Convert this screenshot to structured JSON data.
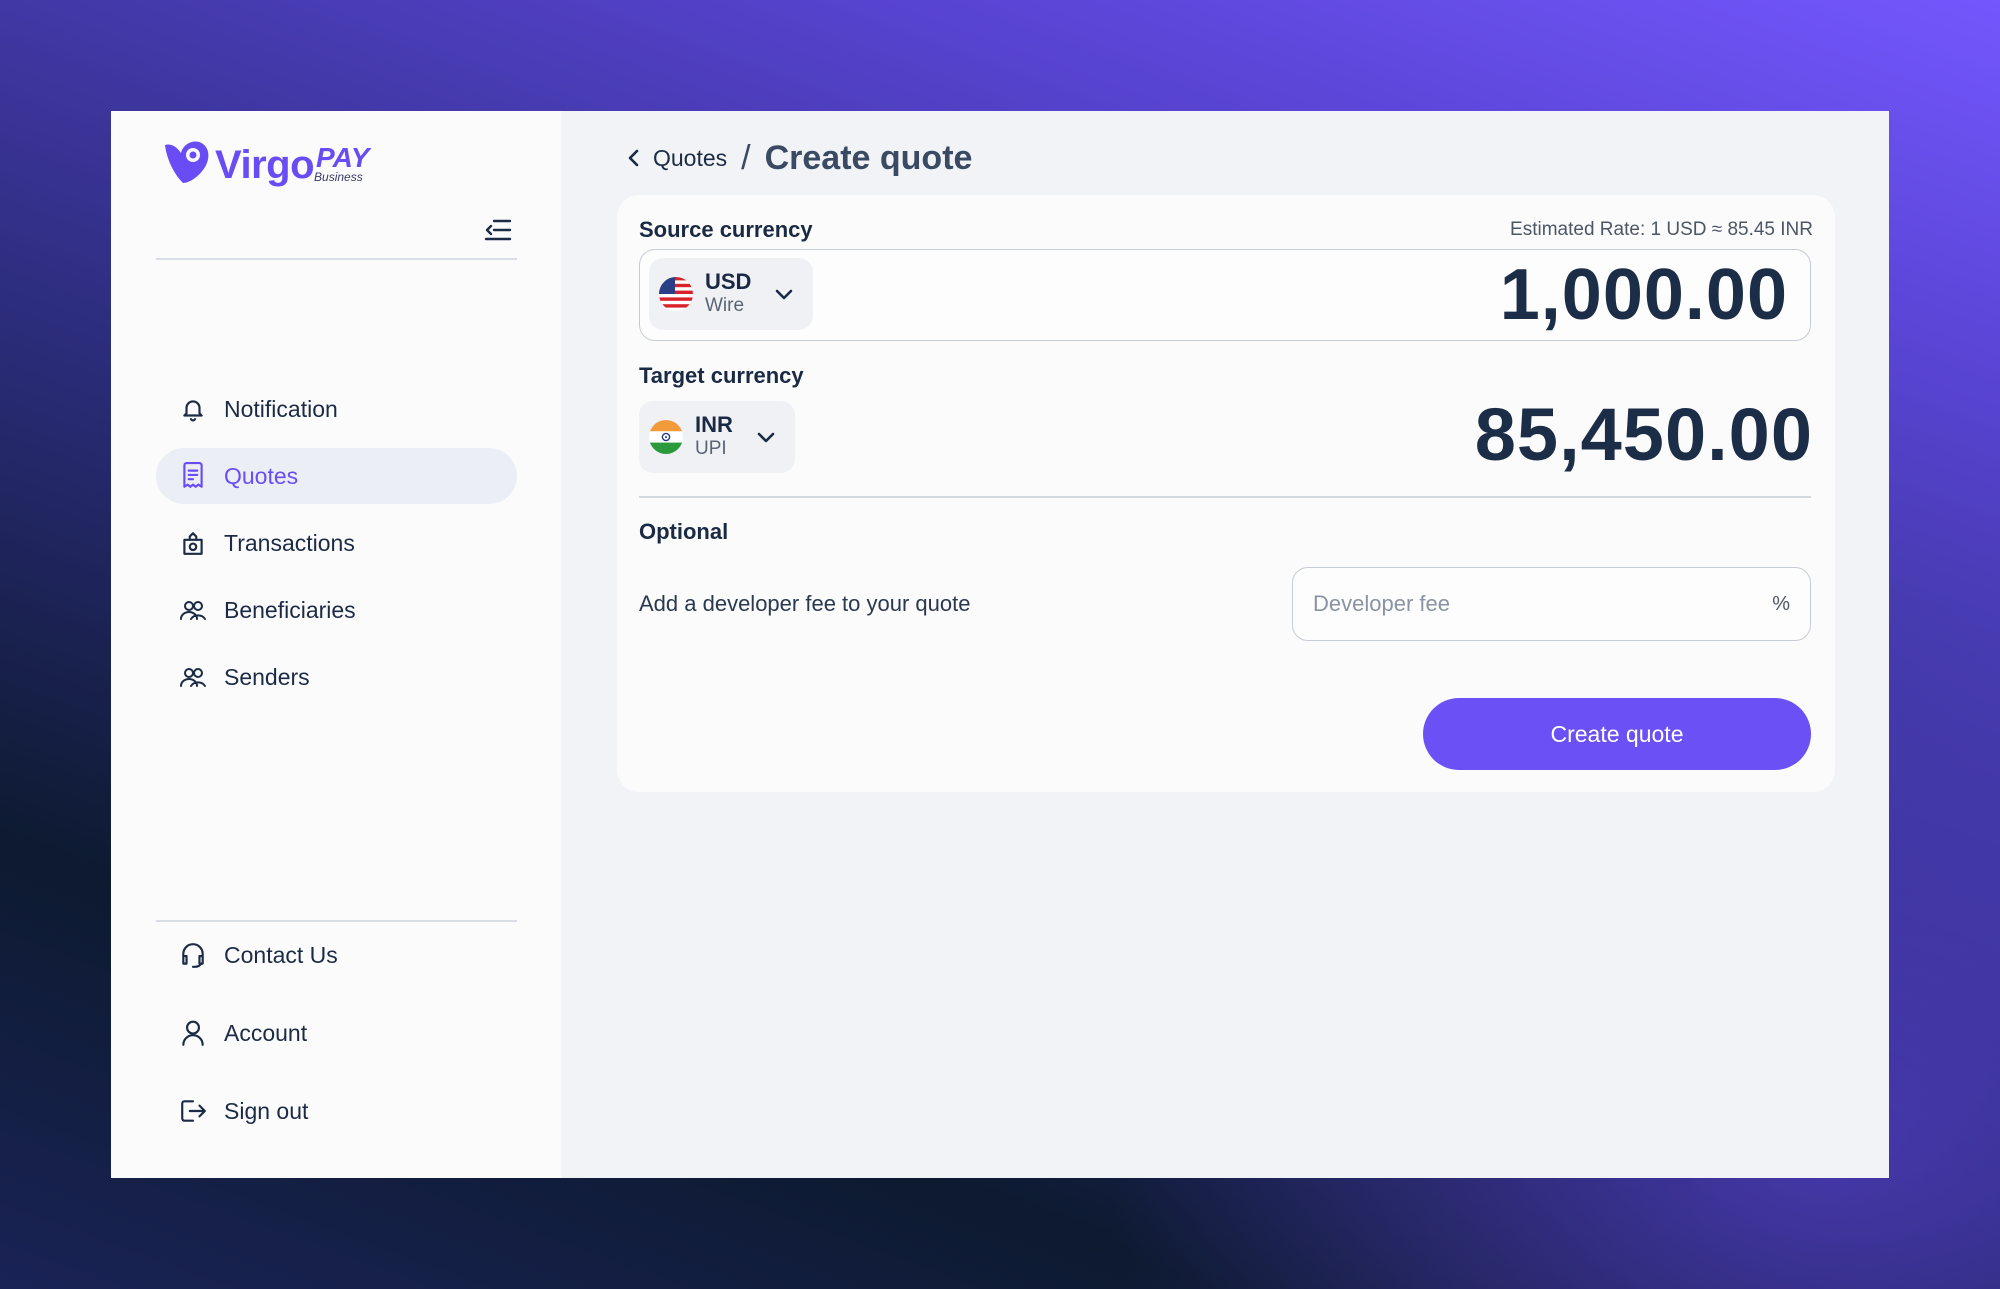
{
  "brand": {
    "name": "Virgo",
    "pay": "PAY",
    "tagline": "Business",
    "accent": "#6a4cf5"
  },
  "sidebar": {
    "collapse_icon": "collapse-menu-icon",
    "items": [
      {
        "label": "Notification",
        "icon": "bell-icon"
      },
      {
        "label": "Quotes",
        "icon": "receipt-icon",
        "active": true
      },
      {
        "label": "Transactions",
        "icon": "bag-transfer-icon"
      },
      {
        "label": "Beneficiaries",
        "icon": "users-icon"
      },
      {
        "label": "Senders",
        "icon": "users-icon"
      }
    ],
    "bottom_items": [
      {
        "label": "Contact Us",
        "icon": "headset-icon"
      },
      {
        "label": "Account",
        "icon": "user-icon"
      },
      {
        "label": "Sign out",
        "icon": "sign-out-icon"
      }
    ]
  },
  "breadcrumb": {
    "back_label": "Quotes",
    "separator": "/",
    "title": "Create quote"
  },
  "quote": {
    "source_label": "Source currency",
    "estimated_rate": "Estimated Rate: 1 USD ≈ 85.45 INR",
    "source": {
      "code": "USD",
      "method": "Wire",
      "amount": "1,000.00"
    },
    "target_label": "Target currency",
    "target": {
      "code": "INR",
      "method": "UPI",
      "amount": "85,450.00"
    },
    "optional_label": "Optional",
    "dev_fee_text": "Add a developer fee to your quote",
    "dev_fee_placeholder": "Developer fee",
    "dev_fee_unit": "%",
    "create_button": "Create quote"
  }
}
